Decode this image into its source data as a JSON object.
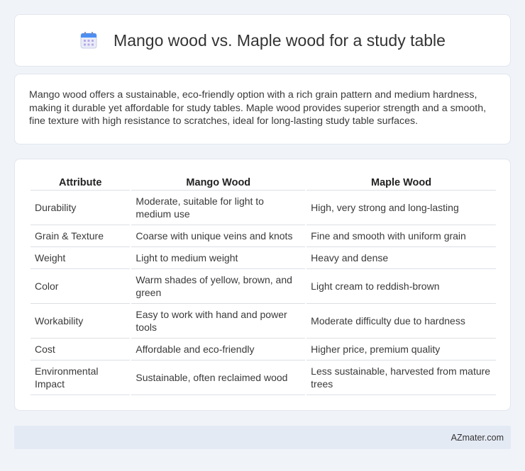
{
  "header": {
    "icon": "calendar-icon",
    "title": "Mango wood vs. Maple wood for a study table"
  },
  "description": "Mango wood offers a sustainable, eco-friendly option with a rich grain pattern and medium hardness, making it durable yet affordable for study tables. Maple wood provides superior strength and a smooth, fine texture with high resistance to scratches, ideal for long-lasting study table surfaces.",
  "table": {
    "headers": [
      "Attribute",
      "Mango Wood",
      "Maple Wood"
    ],
    "rows": [
      [
        "Durability",
        "Moderate, suitable for light to medium use",
        "High, very strong and long-lasting"
      ],
      [
        "Grain & Texture",
        "Coarse with unique veins and knots",
        "Fine and smooth with uniform grain"
      ],
      [
        "Weight",
        "Light to medium weight",
        "Heavy and dense"
      ],
      [
        "Color",
        "Warm shades of yellow, brown, and green",
        "Light cream to reddish-brown"
      ],
      [
        "Workability",
        "Easy to work with hand and power tools",
        "Moderate difficulty due to hardness"
      ],
      [
        "Cost",
        "Affordable and eco-friendly",
        "Higher price, premium quality"
      ],
      [
        "Environmental Impact",
        "Sustainable, often reclaimed wood",
        "Less sustainable, harvested from mature trees"
      ]
    ]
  },
  "footer": {
    "brand": "AZmater.com"
  },
  "colors": {
    "background": "#f0f3f8",
    "card": "#ffffff",
    "footer": "#e4eaf4",
    "icon_top": "#4a8ff5",
    "icon_body": "#e9ecf7"
  }
}
